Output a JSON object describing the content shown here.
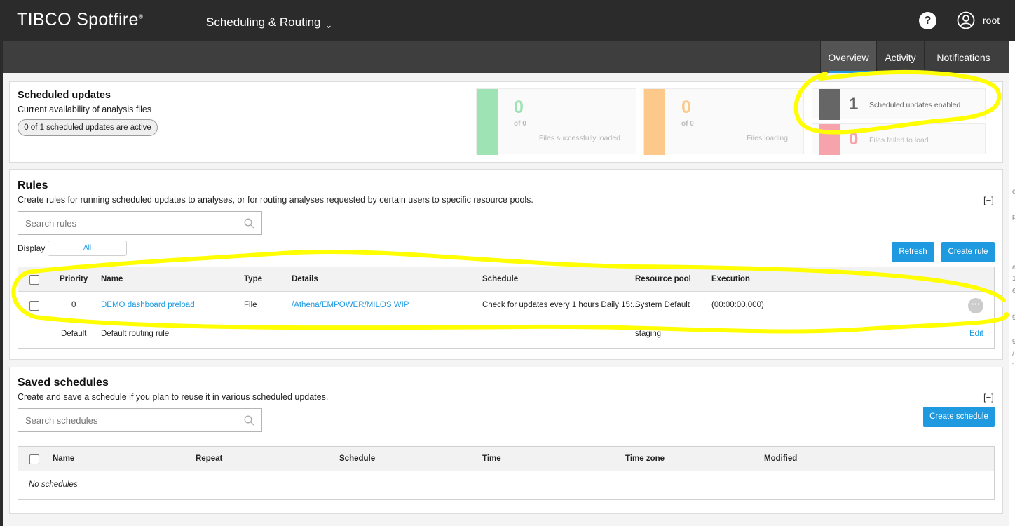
{
  "header": {
    "logo": "TIBCO Spotfire",
    "app_menu": "Scheduling & Routing",
    "help": "?",
    "user": "root"
  },
  "tabs": [
    {
      "label": "Overview",
      "active": true
    },
    {
      "label": "Activity",
      "active": false
    },
    {
      "label": "Notifications",
      "active": false
    }
  ],
  "colors": {
    "accent": "#1f9ae0",
    "success": "#9de3b4",
    "loading": "#fcc98a",
    "enabled": "#666666",
    "failed": "#f7a3ab",
    "highlight": "#ffff00"
  },
  "scheduled": {
    "title": "Scheduled updates",
    "subtitle": "Current availability of analysis files",
    "active_pill": "0 of 1 scheduled updates are active",
    "stats": [
      {
        "value": "0",
        "of": "of 0",
        "label": "Files successfully loaded"
      },
      {
        "value": "0",
        "of": "of 0",
        "label": "Files loading"
      }
    ],
    "enabled": {
      "value": "1",
      "label": "Scheduled updates enabled"
    },
    "failed": {
      "value": "0",
      "label": "Files failed to load"
    }
  },
  "rules": {
    "title": "Rules",
    "subtitle": "Create rules for running scheduled updates to analyses, or for routing analyses requested by certain users to specific resource pools.",
    "collapse": "[−]",
    "search_placeholder": "Search rules",
    "display_label": "Display",
    "display_value": "All",
    "refresh": "Refresh",
    "create": "Create rule",
    "columns": [
      "Priority",
      "Name",
      "Type",
      "Details",
      "Schedule",
      "Resource pool",
      "Execution"
    ],
    "rows": [
      {
        "priority": "0",
        "name": "DEMO dashboard preload",
        "type": "File",
        "details": "/Athena/EMPOWER/MILOS WIP",
        "schedule": "Check for updates every 1 hours Daily 15:...",
        "pool": "System Default",
        "execution": "(00:00:00.000)",
        "more": "···"
      },
      {
        "priority": "Default",
        "name": "Default routing rule",
        "pool": "staging",
        "edit": "Edit"
      }
    ]
  },
  "saved": {
    "title": "Saved schedules",
    "subtitle": "Create and save a schedule if you plan to reuse it in various scheduled updates.",
    "collapse": "[−]",
    "search_placeholder": "Search schedules",
    "create": "Create schedule",
    "columns": [
      "Name",
      "Repeat",
      "Schedule",
      "Time",
      "Time zone",
      "Modified"
    ],
    "empty": "No schedules"
  },
  "side_scraps": [
    "e",
    "p",
    "a",
    "1",
    "6",
    "g",
    "9",
    "/",
    "'"
  ]
}
